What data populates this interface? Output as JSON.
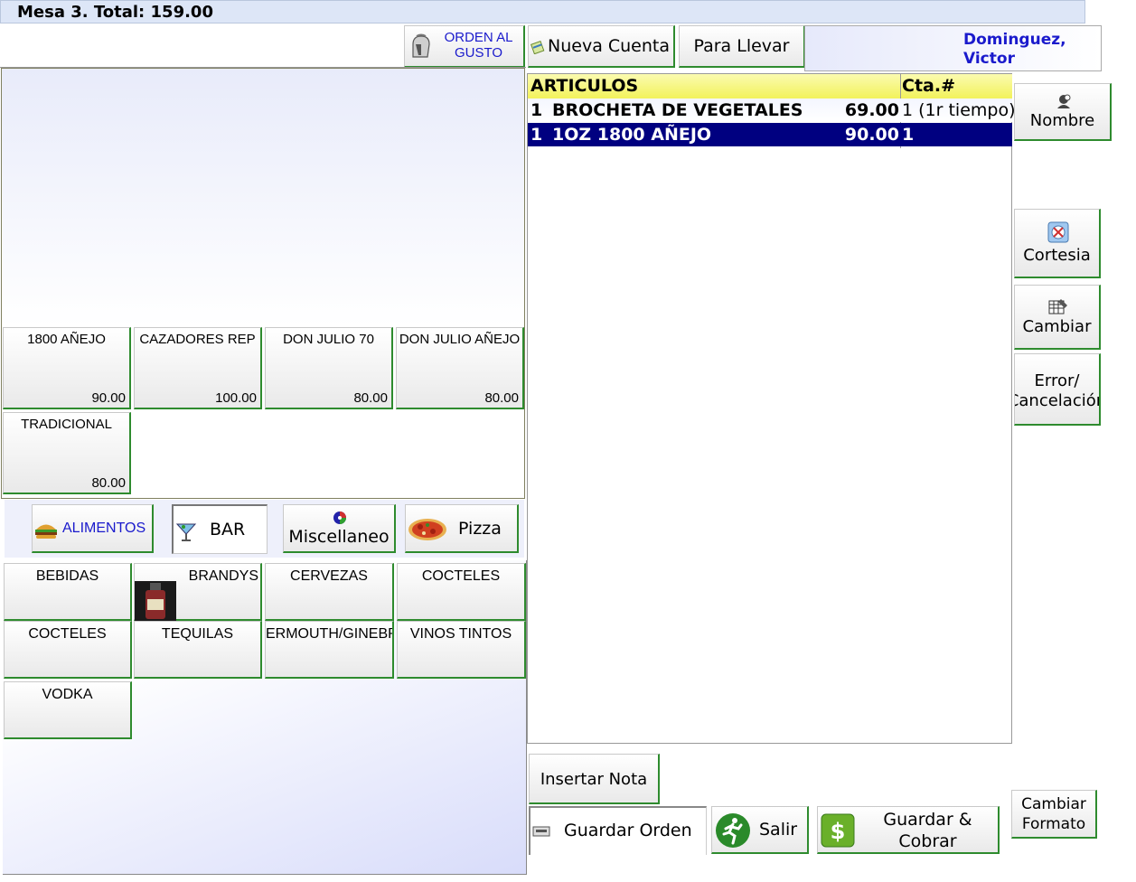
{
  "header": {
    "title": "Mesa 3. Total: 159.00"
  },
  "orden_gusto": {
    "label_line1": "ORDEN AL",
    "label_line2": "GUSTO",
    "icon": "spartan-helmet-icon"
  },
  "top_buttons": {
    "nueva_cuenta": "Nueva Cuenta",
    "para_llevar": "Para Llevar",
    "waiter_line1": "Dominguez,",
    "waiter_line2": "Victor"
  },
  "order_table": {
    "col_articulos": "ARTICULOS",
    "col_cta": "Cta.#",
    "rows": [
      {
        "qty": "1",
        "name": "BROCHETA DE VEGETALES",
        "price": "69.00",
        "cta": "1 (1r tiempo)",
        "selected": false
      },
      {
        "qty": "1",
        "name": "1OZ 1800 AÑEJO",
        "price": "90.00",
        "cta": "1",
        "selected": true
      }
    ]
  },
  "side_buttons": {
    "nombre": "Nombre",
    "cortesia": "Cortesia",
    "cambiar": "Cambiar",
    "error_line1": "Error/",
    "error_line2": "Cancelación"
  },
  "products": [
    {
      "name": "1800 AÑEJO",
      "price": "90.00"
    },
    {
      "name": "CAZADORES REP",
      "price": "100.00"
    },
    {
      "name": "DON JULIO 70",
      "price": "80.00"
    },
    {
      "name": "DON JULIO AÑEJO",
      "price": "80.00"
    },
    {
      "name": "TRADICIONAL",
      "price": "80.00"
    }
  ],
  "menu_tabs": {
    "alimentos": "ALIMENTOS",
    "bar": "BAR",
    "miscellaneo": "Miscellaneo",
    "pizza": "Pizza"
  },
  "categories": [
    "BEBIDAS",
    "BRANDYS",
    "CERVEZAS",
    "COCTELES",
    "COCTELES",
    "TEQUILAS",
    "ERMOUTH/GINEBR",
    "VINOS TINTOS",
    "VODKA"
  ],
  "bottom_buttons": {
    "insertar_nota": "Insertar Nota",
    "guardar_orden": "Guardar Orden",
    "salir": "Salir",
    "guardar_line1": "Guardar &",
    "guardar_line2": "Cobrar",
    "cambiar_line1": "Cambiar",
    "cambiar_line2": "Formato"
  },
  "colors": {
    "accent_blue": "#1a1acc",
    "selected_row": "#000080",
    "header_yellow": "#f2f25a",
    "button_green_border": "#2e8b2e"
  }
}
